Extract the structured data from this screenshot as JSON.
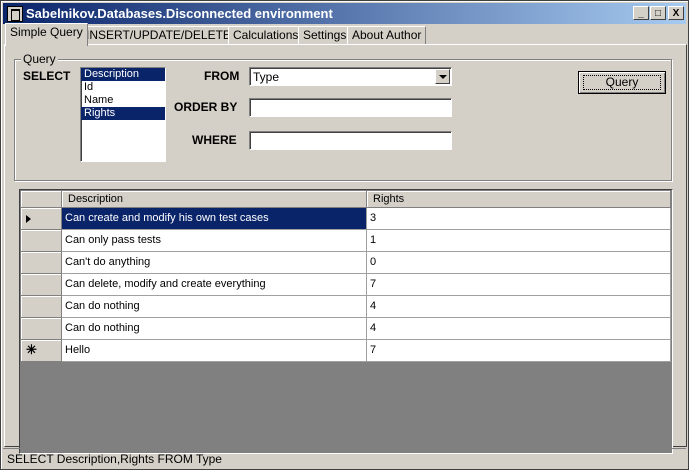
{
  "window": {
    "title": "Sabelnikov.Databases.Disconnected environment",
    "controls": [
      "_",
      "□",
      "X"
    ]
  },
  "tabs": [
    {
      "label": "Simple Query",
      "active": true
    },
    {
      "label": "INSERT/UPDATE/DELETE",
      "active": false
    },
    {
      "label": "Calculations",
      "active": false
    },
    {
      "label": "Settings",
      "active": false
    },
    {
      "label": "About Author",
      "active": false
    }
  ],
  "query": {
    "group_label": "Query",
    "select_label": "SELECT",
    "columns": [
      {
        "label": "Description",
        "selected": true
      },
      {
        "label": "Id",
        "selected": false
      },
      {
        "label": "Name",
        "selected": false
      },
      {
        "label": "Rights",
        "selected": true
      }
    ],
    "from_label": "FROM",
    "from_value": "Type",
    "order_by_label": "ORDER BY",
    "order_by_value": "",
    "where_label": "WHERE",
    "where_value": "",
    "button_label": "Query"
  },
  "grid": {
    "headers": [
      "Description",
      "Rights"
    ],
    "rows": [
      {
        "description": "Can create and modify his own test cases",
        "rights": "3",
        "current": true
      },
      {
        "description": "Can only pass tests",
        "rights": "1"
      },
      {
        "description": "Can't do anything",
        "rights": "0"
      },
      {
        "description": "Can delete, modify and create everything",
        "rights": "7"
      },
      {
        "description": "Can do nothing",
        "rights": "4"
      },
      {
        "description": "Can do nothing",
        "rights": "4"
      },
      {
        "description": "Hello",
        "rights": "7",
        "new_row": true
      }
    ],
    "colors": {
      "selection": "#0a246a",
      "background": "#808080"
    }
  },
  "status": {
    "text": "SELECT Description,Rights FROM Type"
  }
}
